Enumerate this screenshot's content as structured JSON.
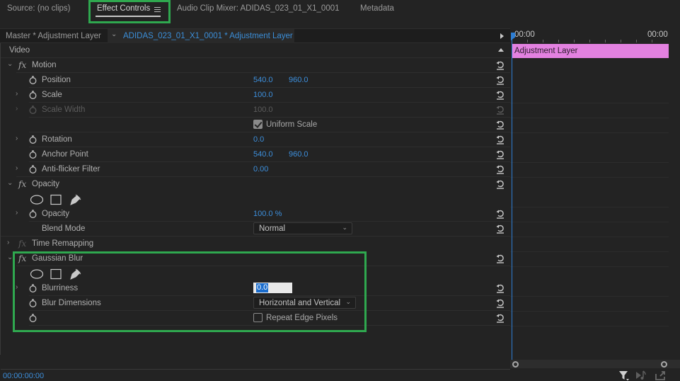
{
  "tabs": [
    {
      "label": "Source: (no clips)",
      "active": false
    },
    {
      "label": "Effect Controls",
      "active": true
    },
    {
      "label": "Audio Clip Mixer: ADIDAS_023_01_X1_0001",
      "active": false
    },
    {
      "label": "Metadata",
      "active": false
    }
  ],
  "clip_header": {
    "master": "Master * Adjustment Layer",
    "sequence": "ADIDAS_023_01_X1_0001 * Adjustment Layer"
  },
  "video_section": "Video",
  "motion": {
    "name": "Motion",
    "position": {
      "label": "Position",
      "x": "540.0",
      "y": "960.0"
    },
    "scale": {
      "label": "Scale",
      "value": "100.0"
    },
    "scale_width": {
      "label": "Scale Width",
      "value": "100.0"
    },
    "uniform_scale": {
      "label": "Uniform Scale",
      "checked": true
    },
    "rotation": {
      "label": "Rotation",
      "value": "0.0"
    },
    "anchor_point": {
      "label": "Anchor Point",
      "x": "540.0",
      "y": "960.0"
    },
    "anti_flicker": {
      "label": "Anti-flicker Filter",
      "value": "0.00"
    }
  },
  "opacity": {
    "name": "Opacity",
    "opacity": {
      "label": "Opacity",
      "value": "100.0 %"
    },
    "blend_mode": {
      "label": "Blend Mode",
      "value": "Normal"
    }
  },
  "time_remapping": {
    "name": "Time Remapping"
  },
  "gaussian_blur": {
    "name": "Gaussian Blur",
    "blurriness": {
      "label": "Blurriness",
      "value": "0.0"
    },
    "blur_dimensions": {
      "label": "Blur Dimensions",
      "value": "Horizontal and Vertical"
    },
    "repeat_edge": {
      "label": "Repeat Edge Pixels",
      "checked": false
    }
  },
  "timeline": {
    "start": "00:00",
    "end": "00:00",
    "clip_name": "Adjustment Layer",
    "clip_color": "#e381e0"
  },
  "current_time": "00:00:00:00",
  "icons": {
    "stopwatch": "stopwatch-icon",
    "reset": "reset-parameter-icon",
    "mask_ellipse": "ellipse-mask-icon",
    "mask_rect": "rectangle-mask-icon",
    "mask_pen": "pen-mask-icon",
    "filter": "filter-icon",
    "play_audio": "play-audio-icon",
    "export": "export-frame-icon"
  },
  "colors": {
    "accent_blue": "#3d8fdc",
    "highlight_green": "#2fa84f"
  }
}
